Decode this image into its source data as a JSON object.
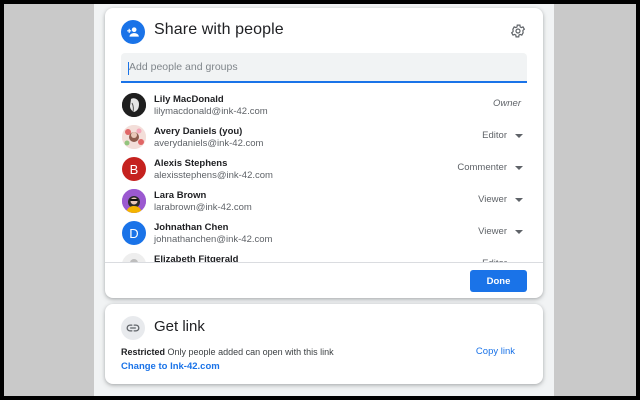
{
  "share": {
    "title": "Share with people",
    "search_placeholder": "Add people and groups",
    "people": [
      {
        "name": "Lily MacDonald",
        "email": "lilymacdonald@ink-42.com",
        "role": "Owner",
        "avatar": "photo-dark",
        "initial": ""
      },
      {
        "name": "Avery Daniels (you)",
        "email": "averydaniels@ink-42.com",
        "role": "Editor",
        "avatar": "photo-flowers",
        "initial": ""
      },
      {
        "name": "Alexis Stephens",
        "email": "alexisstephens@ink-42.com",
        "role": "Commenter",
        "avatar": "letter",
        "initial": "B",
        "color": "#c5221f"
      },
      {
        "name": "Lara Brown",
        "email": "larabrown@ink-42.com",
        "role": "Viewer",
        "avatar": "photo-purple",
        "initial": ""
      },
      {
        "name": "Johnathan Chen",
        "email": "johnathanchen@ink-42.com",
        "role": "Viewer",
        "avatar": "letter",
        "initial": "D",
        "color": "#1a73e8"
      },
      {
        "name": "Elizabeth Fitgerald",
        "email": "",
        "role": "Editor",
        "avatar": "photo-light",
        "initial": ""
      }
    ],
    "done_label": "Done"
  },
  "link": {
    "title": "Get link",
    "restricted_label": "Restricted",
    "restricted_desc": "Only people added can open with this link",
    "copy_label": "Copy link",
    "change_label": "Change to Ink-42.com"
  },
  "colors": {
    "accent": "#1a73e8",
    "backdrop": "#c9c9c9"
  }
}
